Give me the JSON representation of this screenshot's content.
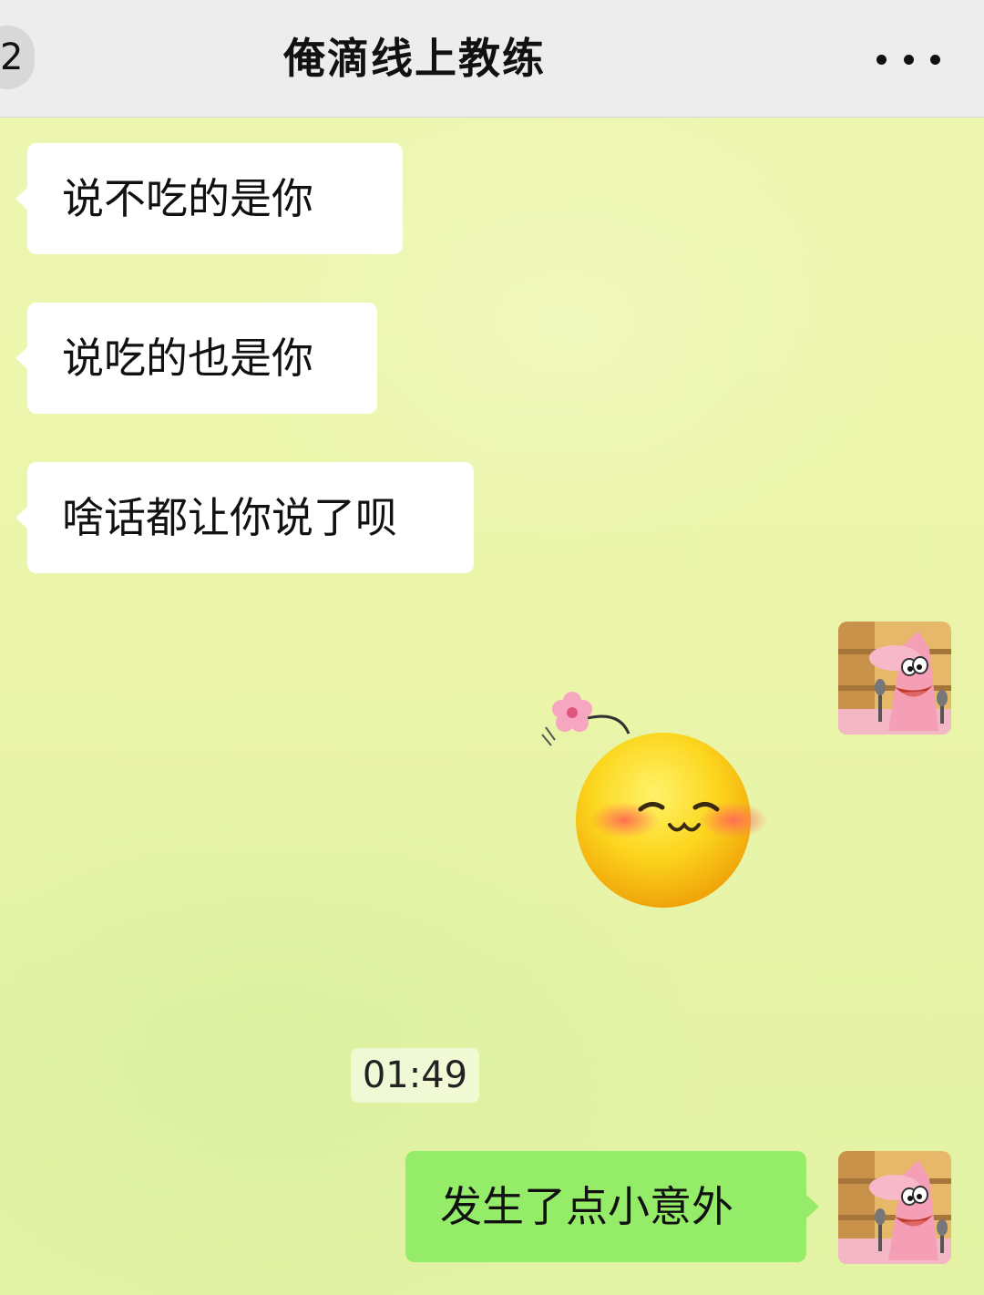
{
  "header": {
    "back_count": "2",
    "title": "俺滴线上教练",
    "more_icon": "more-dots-icon"
  },
  "messages": [
    {
      "side": "left",
      "text": "说不吃的是你"
    },
    {
      "side": "left",
      "text": "说吃的也是你"
    },
    {
      "side": "left",
      "text": "啥话都让你说了呗"
    },
    {
      "side": "right",
      "type": "sticker",
      "sticker": "blushing-smile-flower-emoji"
    },
    {
      "type": "time",
      "text": "01:49"
    },
    {
      "side": "right",
      "text": "发生了点小意外"
    }
  ],
  "colors": {
    "header_bg": "#ededed",
    "chat_bg": "#eaf5a9",
    "left_bubble": "#ffffff",
    "right_bubble": "#95ec69"
  },
  "avatar": {
    "icon": "patrick-star-avatar"
  }
}
